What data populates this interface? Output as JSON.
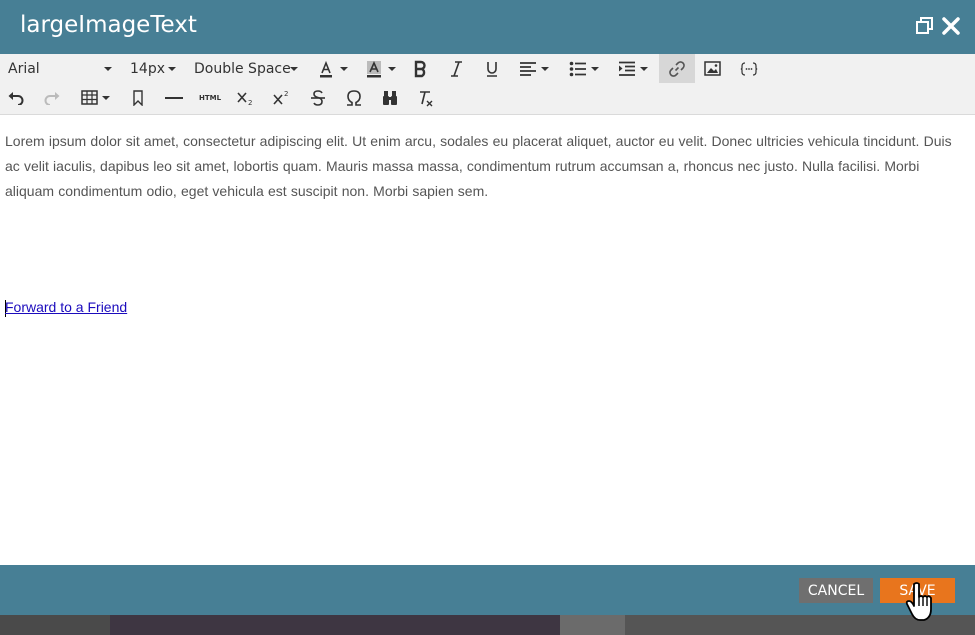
{
  "dialog": {
    "title": "largeImageText",
    "restore_icon": "restore-window-icon",
    "close_icon": "close-icon"
  },
  "toolbar": {
    "font_family": "Arial",
    "font_size": "14px",
    "line_spacing": "Double Space",
    "html_label": "HTML",
    "icons": [
      "font-color-icon",
      "highlight-color-icon",
      "bold-icon",
      "italic-icon",
      "underline-icon",
      "align-icon",
      "bullet-list-icon",
      "indent-icon",
      "link-icon",
      "image-icon",
      "token-icon",
      "undo-icon",
      "redo-icon",
      "table-icon",
      "bookmark-icon",
      "horizontal-rule-icon",
      "html-icon",
      "subscript-icon",
      "superscript-icon",
      "strikethrough-icon",
      "special-character-icon",
      "find-replace-icon",
      "clear-formatting-icon"
    ]
  },
  "editor": {
    "paragraph": "Lorem ipsum dolor sit amet, consectetur adipiscing elit. Ut enim arcu, sodales eu placerat aliquet, auctor eu velit. Donec ultricies vehicula tincidunt. Duis ac velit iaculis, dapibus leo sit amet, lobortis quam. Mauris massa massa, condimentum rutrum accumsan a, rhoncus nec justo. Nulla facilisi. Morbi aliquam condimentum odio, eget vehicula est suscipit non. Morbi sapien sem.",
    "link_text": "Forward to a Friend"
  },
  "footer": {
    "cancel_label": "CANCEL",
    "save_label": "SAVE"
  },
  "colors": {
    "header_bg": "#477f95",
    "save_bg": "#e8751d",
    "cancel_bg": "#6f6f6f",
    "link": "#1b0bbd"
  }
}
